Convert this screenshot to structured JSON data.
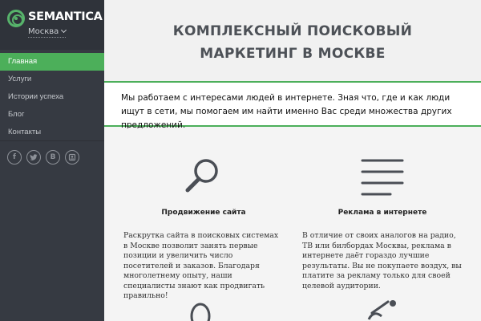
{
  "brand": {
    "name": "SEMANTICA",
    "city": "Москва"
  },
  "nav": {
    "items": [
      {
        "label": "Главная",
        "active": true
      },
      {
        "label": "Услуги",
        "active": false
      },
      {
        "label": "Истории успеха",
        "active": false
      },
      {
        "label": "Блог",
        "active": false
      },
      {
        "label": "Контакты",
        "active": false
      }
    ]
  },
  "social": [
    {
      "icon": "facebook-icon",
      "glyph": "f"
    },
    {
      "icon": "twitter-icon",
      "glyph": "t"
    },
    {
      "icon": "vk-icon",
      "glyph": "B"
    },
    {
      "icon": "odnoklassniki-icon",
      "glyph": "ok"
    }
  ],
  "hero": {
    "title_line1": "КОМПЛЕКСНЫЙ ПОИСКОВЫЙ",
    "title_line2": "МАРКЕТИНГ В МОСКВЕ"
  },
  "intro": {
    "text": "Мы работаем с интересами людей в интернете. Зная что, где и как люди ищут в сети, мы помогаем им найти именно Вас среди множества других предложений."
  },
  "services": [
    {
      "title": "Продвижение сайта",
      "icon": "magnifier-icon",
      "text": "Раскрутка сайта в поисковых системах в Москве позволит занять первые позиции и увеличить число посетителей и заказов. Благодаря многолетнему опыту, наши специалисты знают как продвигать правильно!"
    },
    {
      "title": "Реклама в интернете",
      "icon": "menu-lines-icon",
      "text": "В отличие от своих аналогов на радио, ТВ или билбордах Москвы, реклама в интернете даёт гораздо лучшие результаты. Вы не покупаете воздух, вы платите за рекламу только для своей целевой аудитории."
    }
  ],
  "colors": {
    "accent": "#4caf5a",
    "sidebar": "#363a42",
    "heading": "#4d5157"
  }
}
